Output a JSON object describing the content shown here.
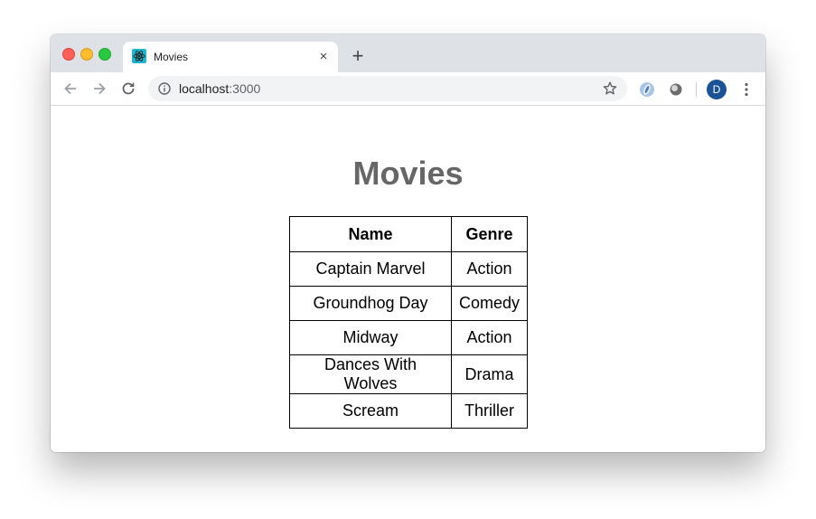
{
  "browser": {
    "tab_title": "Movies",
    "close_glyph": "×",
    "new_tab_glyph": "+",
    "url_host": "localhost",
    "url_port": ":3000",
    "avatar_initial": "D",
    "icons": [
      "react-favicon-icon",
      "back-icon",
      "forward-icon",
      "reload-icon",
      "info-icon",
      "star-icon",
      "extension-icon",
      "extension-icon",
      "more-icon"
    ]
  },
  "page": {
    "title": "Movies",
    "table": {
      "headers": [
        "Name",
        "Genre"
      ],
      "rows": [
        [
          "Captain Marvel",
          "Action"
        ],
        [
          "Groundhog Day",
          "Comedy"
        ],
        [
          "Midway",
          "Action"
        ],
        [
          "Dances With Wolves",
          "Drama"
        ],
        [
          "Scream",
          "Thriller"
        ]
      ]
    }
  },
  "colors": {
    "tab_bar": "#dee1e6",
    "title_text": "#666666",
    "avatar": "#1a5296"
  }
}
